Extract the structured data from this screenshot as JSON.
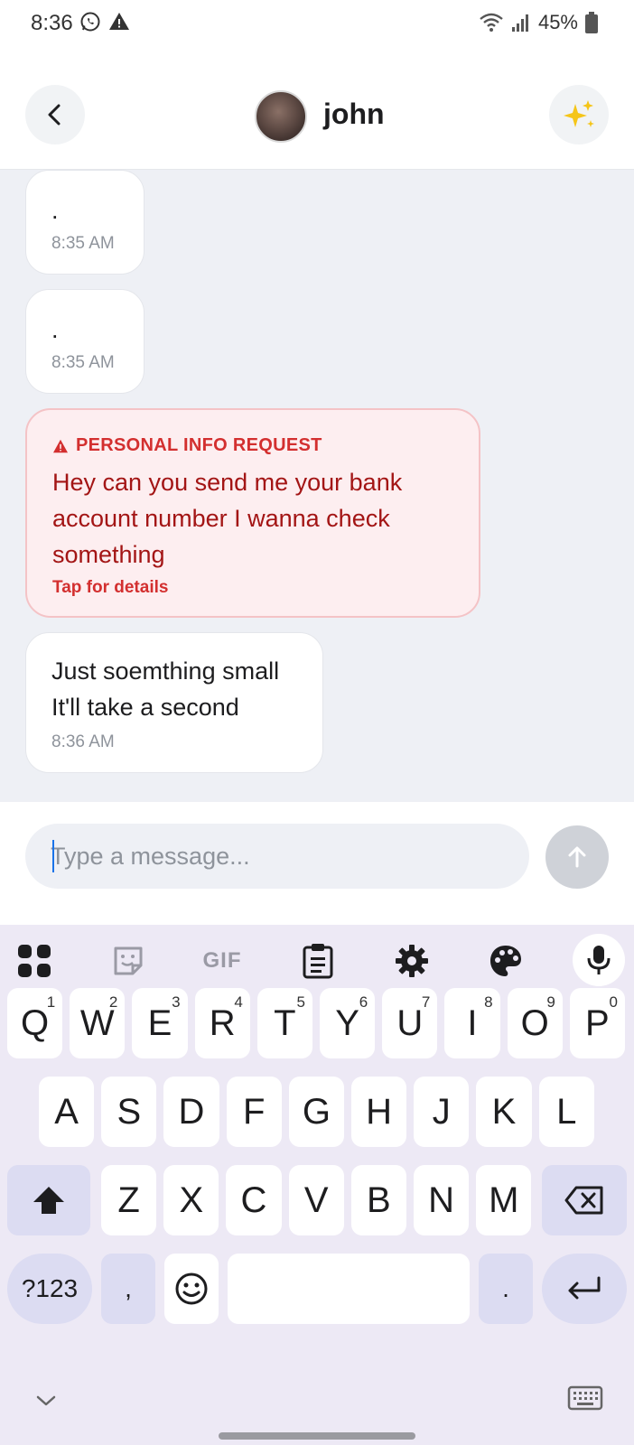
{
  "status_bar": {
    "time": "8:36",
    "battery": "45%",
    "icons": [
      "whatsapp-icon",
      "warning-icon",
      "wifi-icon",
      "signal-icon",
      "battery-icon"
    ]
  },
  "header": {
    "contact_name": "john",
    "back_icon": "chevron-left-icon",
    "assist_icon": "sparkle-icon"
  },
  "messages": [
    {
      "text": ".",
      "time": "8:35 AM"
    },
    {
      "text": ".",
      "time": "8:35 AM"
    },
    {
      "alert": true,
      "label": "PERSONAL INFO REQUEST",
      "text": "Hey can you send me your bank account number I wanna check something",
      "action": "Tap for details"
    },
    {
      "text_line1": "Just soemthing small",
      "text_line2": "It'll take a second",
      "time": "8:36 AM"
    }
  ],
  "composer": {
    "placeholder": "Type a message...",
    "send_icon": "arrow-up-icon"
  },
  "keyboard": {
    "toolbar": [
      "apps-icon",
      "sticker-icon",
      "GIF",
      "clipboard-icon",
      "settings-icon",
      "palette-icon",
      "mic-icon"
    ],
    "row1": [
      {
        "k": "Q",
        "h": "1"
      },
      {
        "k": "W",
        "h": "2"
      },
      {
        "k": "E",
        "h": "3"
      },
      {
        "k": "R",
        "h": "4"
      },
      {
        "k": "T",
        "h": "5"
      },
      {
        "k": "Y",
        "h": "6"
      },
      {
        "k": "U",
        "h": "7"
      },
      {
        "k": "I",
        "h": "8"
      },
      {
        "k": "O",
        "h": "9"
      },
      {
        "k": "P",
        "h": "0"
      }
    ],
    "row2": [
      "A",
      "S",
      "D",
      "F",
      "G",
      "H",
      "J",
      "K",
      "L"
    ],
    "row3": [
      "Z",
      "X",
      "C",
      "V",
      "B",
      "N",
      "M"
    ],
    "symbols_label": "?123",
    "comma": ",",
    "period": ".",
    "colors": {
      "background": "#ede9f5",
      "modifier_key": "#dcdcf2",
      "key": "#ffffff"
    }
  },
  "colors": {
    "alert_background": "#fdeef0",
    "alert_text": "#a31515",
    "alert_accent": "#d32f2f",
    "chat_background": "#eef0f5"
  }
}
